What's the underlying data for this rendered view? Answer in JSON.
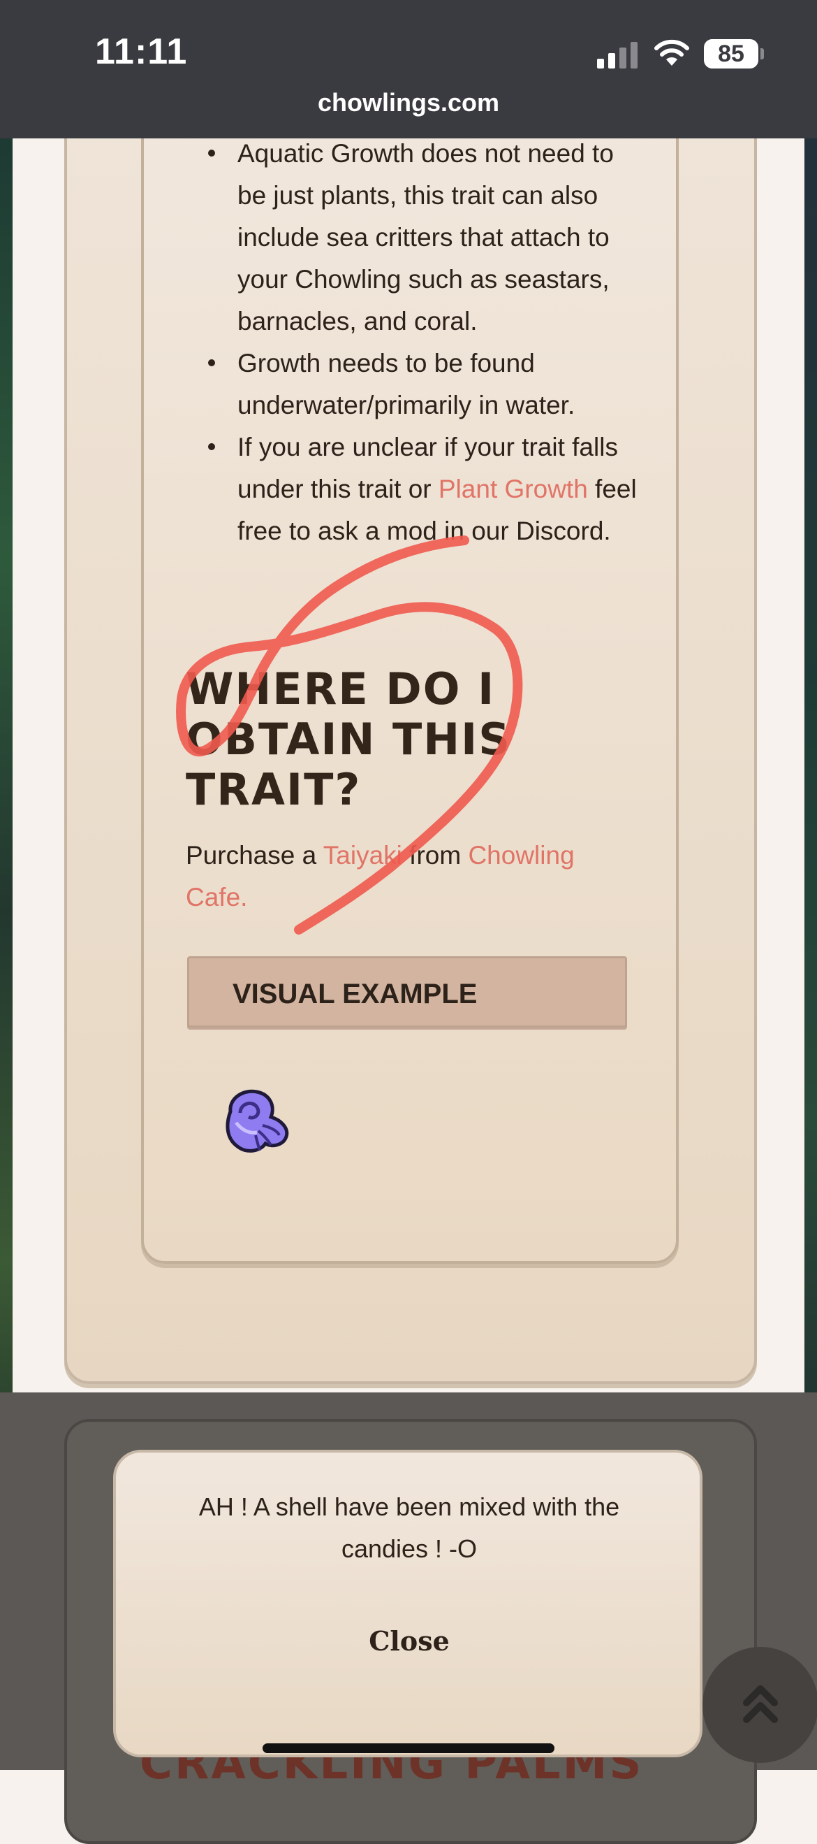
{
  "status_bar": {
    "time": "11:11",
    "battery": "85"
  },
  "browser": {
    "url": "chowlings.com"
  },
  "content": {
    "bullets": [
      {
        "text": "Aquatic Growth does not need to be just plants, this trait can also include sea critters that attach to your Chowling such as seastars, barnacles, and coral."
      },
      {
        "text": "Growth needs to be found underwater/primarily in water."
      },
      {
        "before": "If you are unclear if your trait falls under this trait or ",
        "link": "Plant Growth",
        "after": " feel free to ask a mod in our Discord."
      }
    ],
    "heading": "WHERE DO I OBTAIN THIS TRAIT?",
    "purchase": {
      "prefix": "Purchase a ",
      "item_link": "Taiyaki",
      "middle": " from ",
      "shop_link": "Chowling Cafe."
    },
    "visual_example_label": "VISUAL EXAMPLE",
    "next_section_title": "CRACKLING PALMS"
  },
  "modal": {
    "message": "AH ! A shell have been mixed with the candies ! -O",
    "close_label": "Close"
  },
  "icons": {
    "shell": "shell-icon",
    "scroll_top": "double-chevron-up-icon"
  },
  "colors": {
    "link": "#e07467",
    "button": "#d3b4a0",
    "scribble": "#f05a4f"
  }
}
